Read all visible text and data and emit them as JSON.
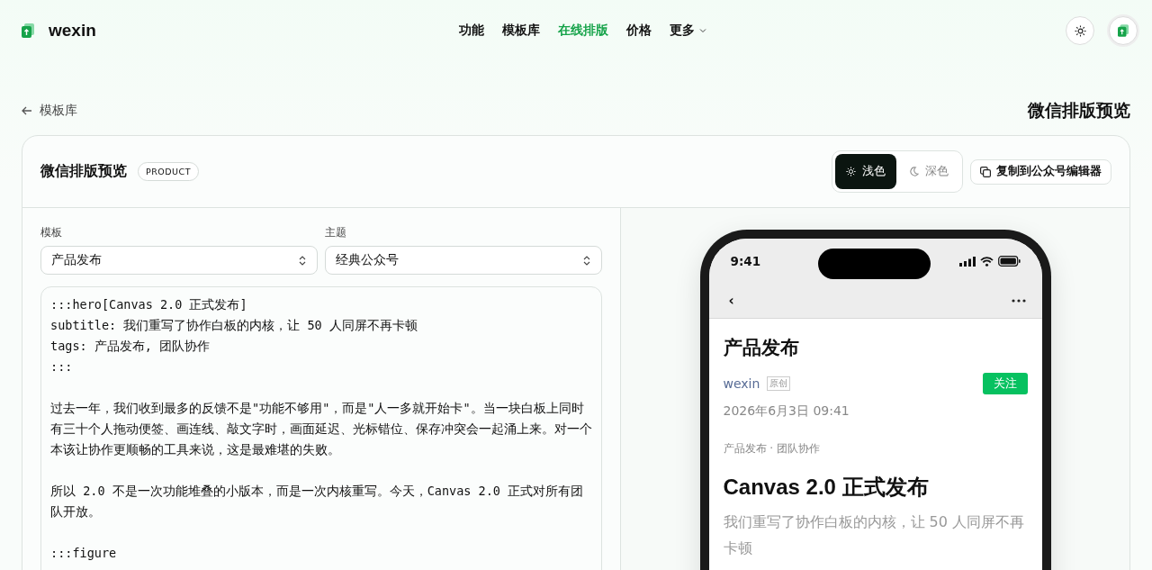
{
  "nav": {
    "brand": "wexin",
    "links": [
      {
        "label": "功能",
        "selected": false
      },
      {
        "label": "模板库",
        "selected": false
      },
      {
        "label": "在线排版",
        "selected": true
      },
      {
        "label": "价格",
        "selected": false
      }
    ],
    "more": "更多"
  },
  "back_link": "模板库",
  "page_title": "微信排版预览",
  "card": {
    "title": "微信排版预览",
    "badge": "PRODUCT",
    "theme_toggle": [
      {
        "label": "浅色",
        "kind": "sun",
        "selected": true
      },
      {
        "label": "深色",
        "kind": "moon",
        "selected": false
      }
    ],
    "copy_button": "复制到公众号编辑器"
  },
  "fields": [
    {
      "label": "模板",
      "value": "产品发布"
    },
    {
      "label": "主题",
      "value": "经典公众号"
    }
  ],
  "editor": {
    "blocks": [
      {
        "lines": [
          ":::hero[Canvas 2.0 正式发布]",
          "subtitle: 我们重写了协作白板的内核，让 50 人同屏不再卡顿",
          "tags: 产品发布, 团队协作",
          ":::"
        ]
      },
      {
        "lines": [
          "过去一年，我们收到最多的反馈不是\"功能不够用\"，而是\"人一多就开始卡\"。当一块白板上同时有三十个人拖动便签、画连线、敲文字时，画面延迟、光标错位、保存冲突会一起涌上来。对一个本该让协作更顺畅的工具来说，这是最难堪的失败。"
        ]
      },
      {
        "lines": [
          "所以 2.0 不是一次功能堆叠的小版本，而是一次内核重写。今天，Canvas 2.0 正式对所有团队开放。"
        ]
      },
      {
        "lines": [
          ":::figure"
        ]
      }
    ]
  },
  "phone": {
    "time": "9:41",
    "back": "‹",
    "account": "产品发布",
    "author": "wexin",
    "original_tag": "原创",
    "follow": "关注",
    "date": "2026年6月3日 09:41",
    "tags": "产品发布 · 团队协作",
    "headline": "Canvas 2.0 正式发布",
    "subtitle": "我们重写了协作白板的内核，让 50 人同屏不再卡顿"
  }
}
